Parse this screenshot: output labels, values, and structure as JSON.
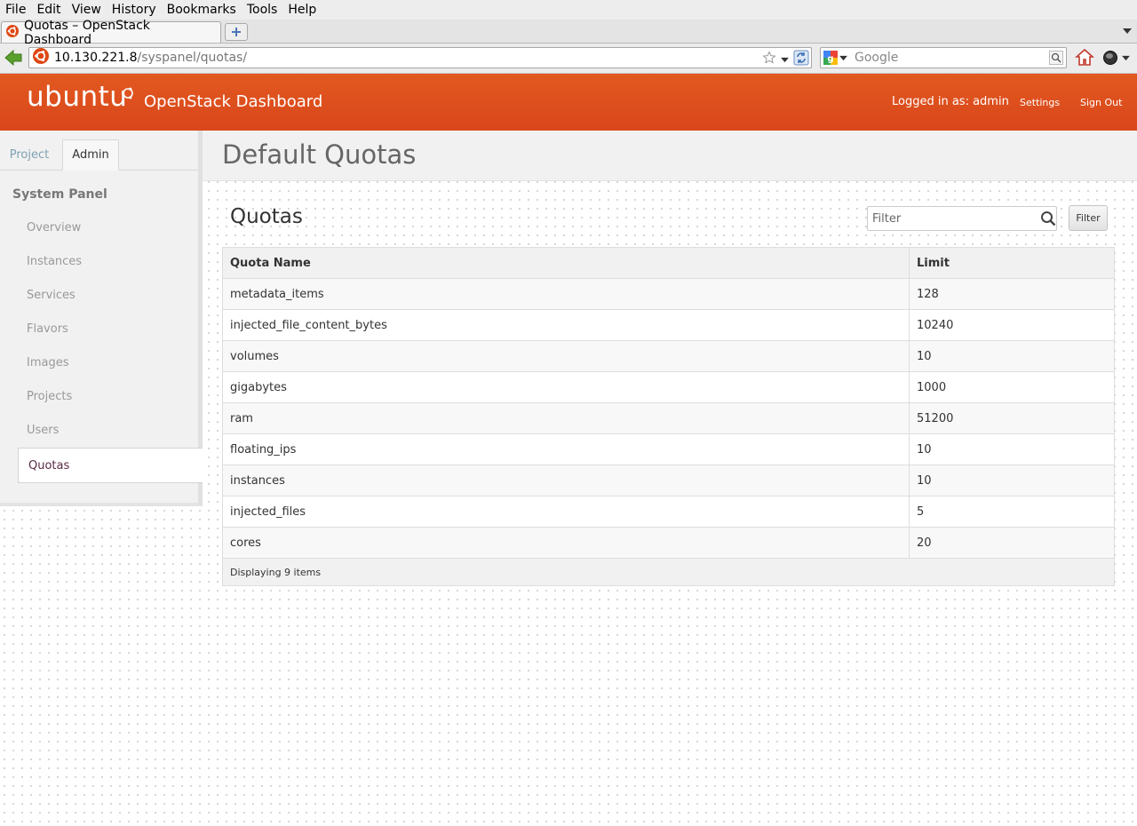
{
  "browser": {
    "menu": [
      "File",
      "Edit",
      "View",
      "History",
      "Bookmarks",
      "Tools",
      "Help"
    ],
    "tab_title": "Quotas – OpenStack Dashboard",
    "url_host": "10.130.221.8",
    "url_path": "/syspanel/quotas/",
    "search_placeholder": "Google"
  },
  "header": {
    "brand": "ubuntu",
    "site_title": "OpenStack Dashboard",
    "user_info": "Logged in as: admin",
    "settings_label": "Settings",
    "signout_label": "Sign Out"
  },
  "sidebar": {
    "tabs": [
      {
        "label": "Project"
      },
      {
        "label": "Admin"
      }
    ],
    "panel_heading": "System Panel",
    "items": [
      {
        "label": "Overview"
      },
      {
        "label": "Instances"
      },
      {
        "label": "Services"
      },
      {
        "label": "Flavors"
      },
      {
        "label": "Images"
      },
      {
        "label": "Projects"
      },
      {
        "label": "Users"
      },
      {
        "label": "Quotas"
      }
    ]
  },
  "main": {
    "page_title": "Default Quotas",
    "section_title": "Quotas",
    "filter_placeholder": "Filter",
    "filter_button": "Filter",
    "table": {
      "columns": [
        "Quota Name",
        "Limit"
      ],
      "rows": [
        {
          "name": "metadata_items",
          "limit": "128"
        },
        {
          "name": "injected_file_content_bytes",
          "limit": "10240"
        },
        {
          "name": "volumes",
          "limit": "10"
        },
        {
          "name": "gigabytes",
          "limit": "1000"
        },
        {
          "name": "ram",
          "limit": "51200"
        },
        {
          "name": "floating_ips",
          "limit": "10"
        },
        {
          "name": "instances",
          "limit": "10"
        },
        {
          "name": "injected_files",
          "limit": "5"
        },
        {
          "name": "cores",
          "limit": "20"
        }
      ],
      "footer": "Displaying 9 items"
    }
  },
  "colors": {
    "header_orange": "#dd4f1d",
    "active_nav": "#5b2a46",
    "inactive_tab": "#7ea1b3"
  }
}
